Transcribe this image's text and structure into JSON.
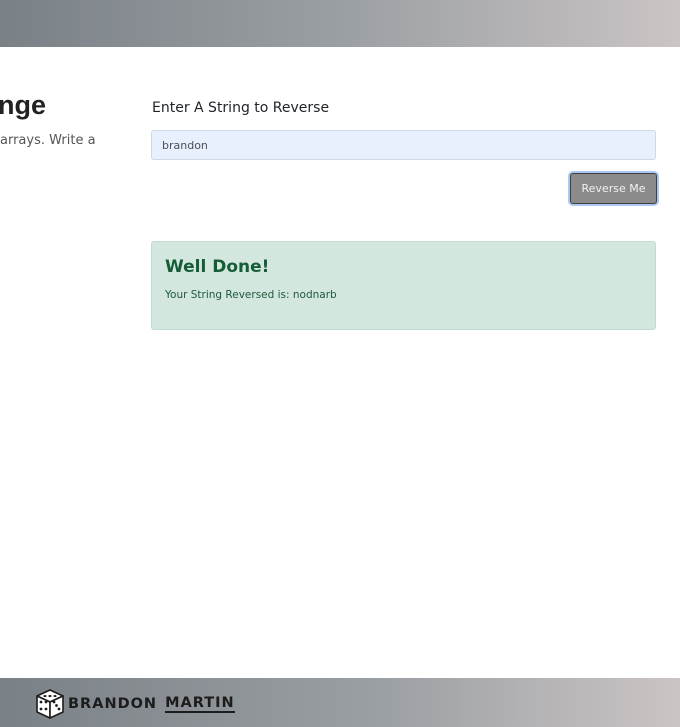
{
  "left_panel": {
    "title_fragment": "nge",
    "description_fragment": "arrays. Write a"
  },
  "form": {
    "label": "Enter A String to Reverse",
    "input_value": "brandon",
    "button_label": "Reverse Me"
  },
  "result": {
    "heading": "Well Done!",
    "message": "Your String Reversed is: nodnarb"
  },
  "footer": {
    "brand_first": "BRANDON",
    "brand_last": "MARTIN",
    "logo_icon": "dice-icon"
  },
  "colors": {
    "alert_background": "#d3e7de",
    "alert_text": "#155c37",
    "button_background": "#8b8b8b",
    "input_background": "#e8f0fe"
  }
}
